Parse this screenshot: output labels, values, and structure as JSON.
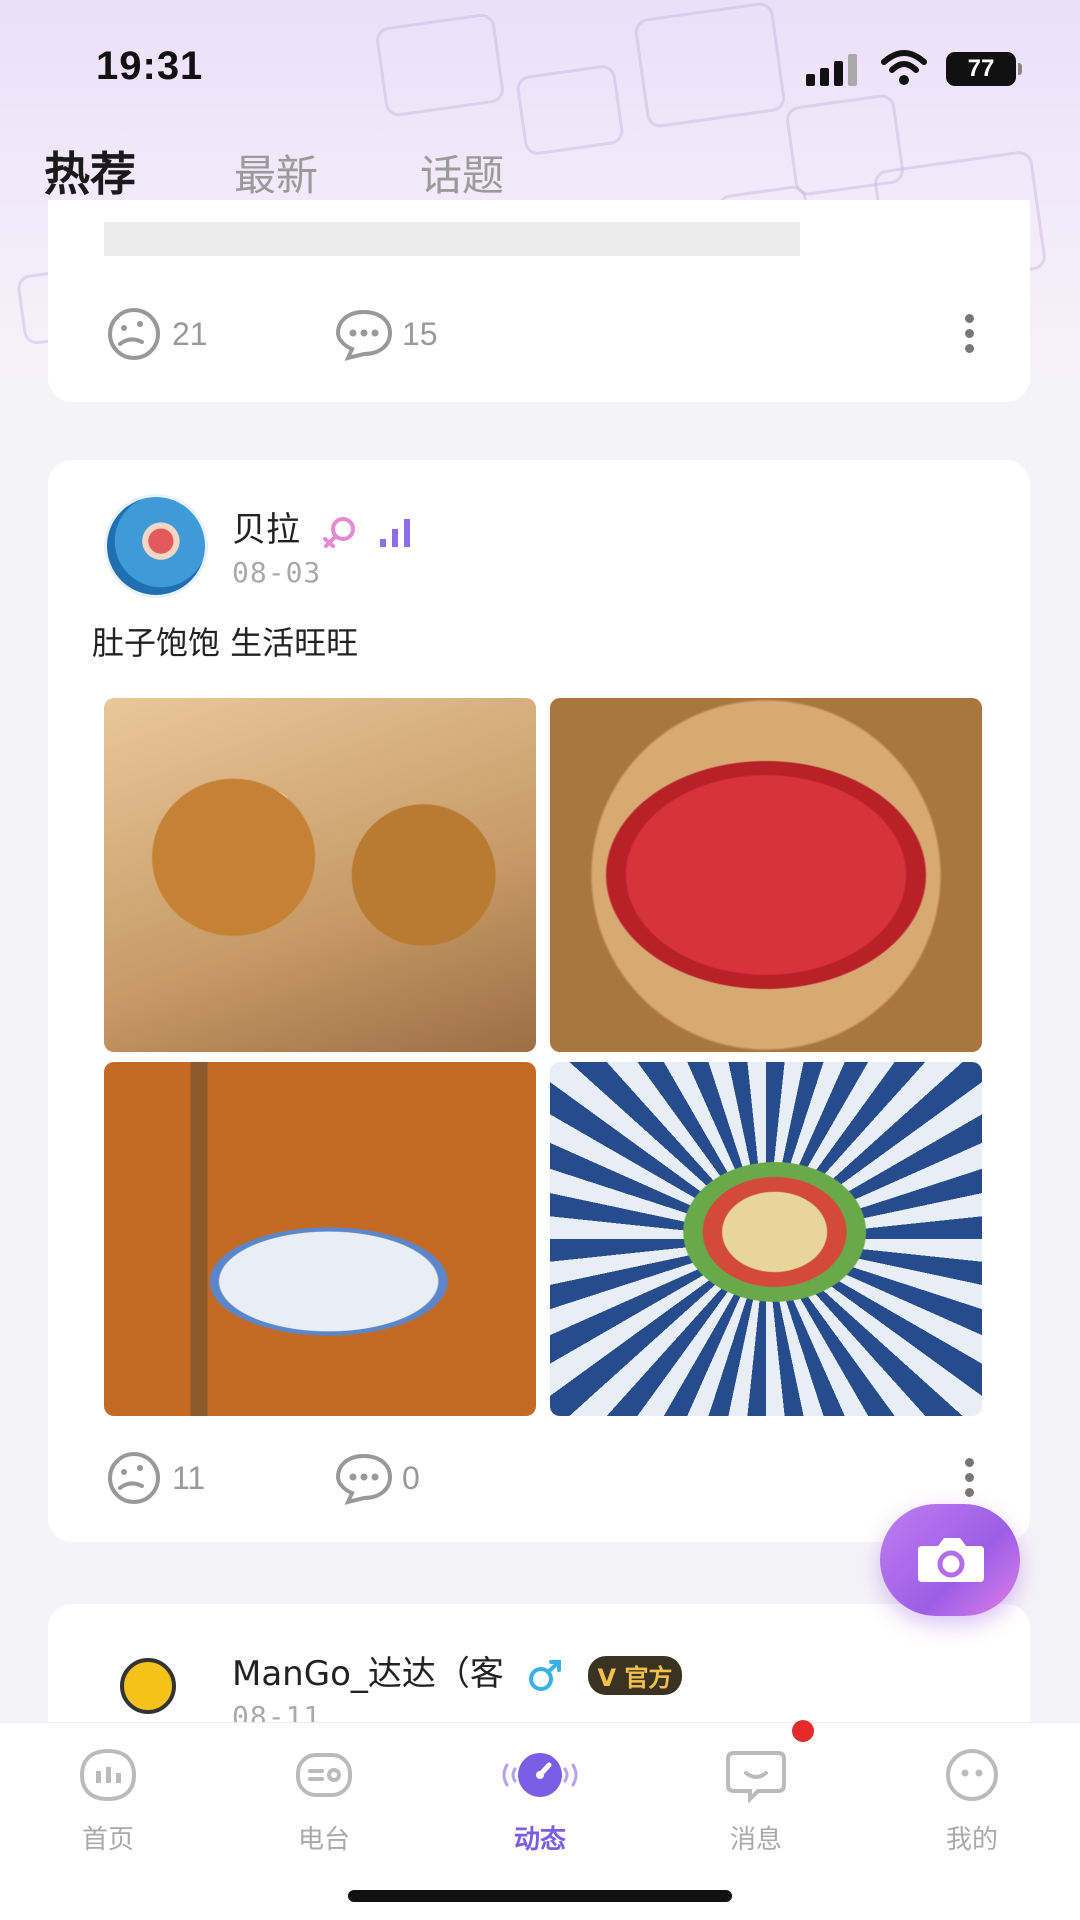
{
  "status_bar": {
    "time": "19:31",
    "battery": "77"
  },
  "tabs": [
    {
      "label": "热荐",
      "active": true
    },
    {
      "label": "最新",
      "active": false
    },
    {
      "label": "话题",
      "active": false
    }
  ],
  "post1": {
    "likes": "21",
    "comments": "15"
  },
  "post2": {
    "username": "贝拉",
    "date": "08-03",
    "text": "肚子饱饱 生活旺旺",
    "likes": "11",
    "comments": "0"
  },
  "post3": {
    "username": "ManGo_达达（客",
    "date": "08-11",
    "badge": "官方"
  },
  "bottom_nav": [
    {
      "label": "首页",
      "icon": "home-icon"
    },
    {
      "label": "电台",
      "icon": "radio-icon"
    },
    {
      "label": "动态",
      "icon": "moments-icon",
      "active": true
    },
    {
      "label": "消息",
      "icon": "message-icon"
    },
    {
      "label": "我的",
      "icon": "profile-icon"
    }
  ],
  "colors": {
    "accent": "#7b5de6",
    "badge_dot": "#e62a2a"
  }
}
